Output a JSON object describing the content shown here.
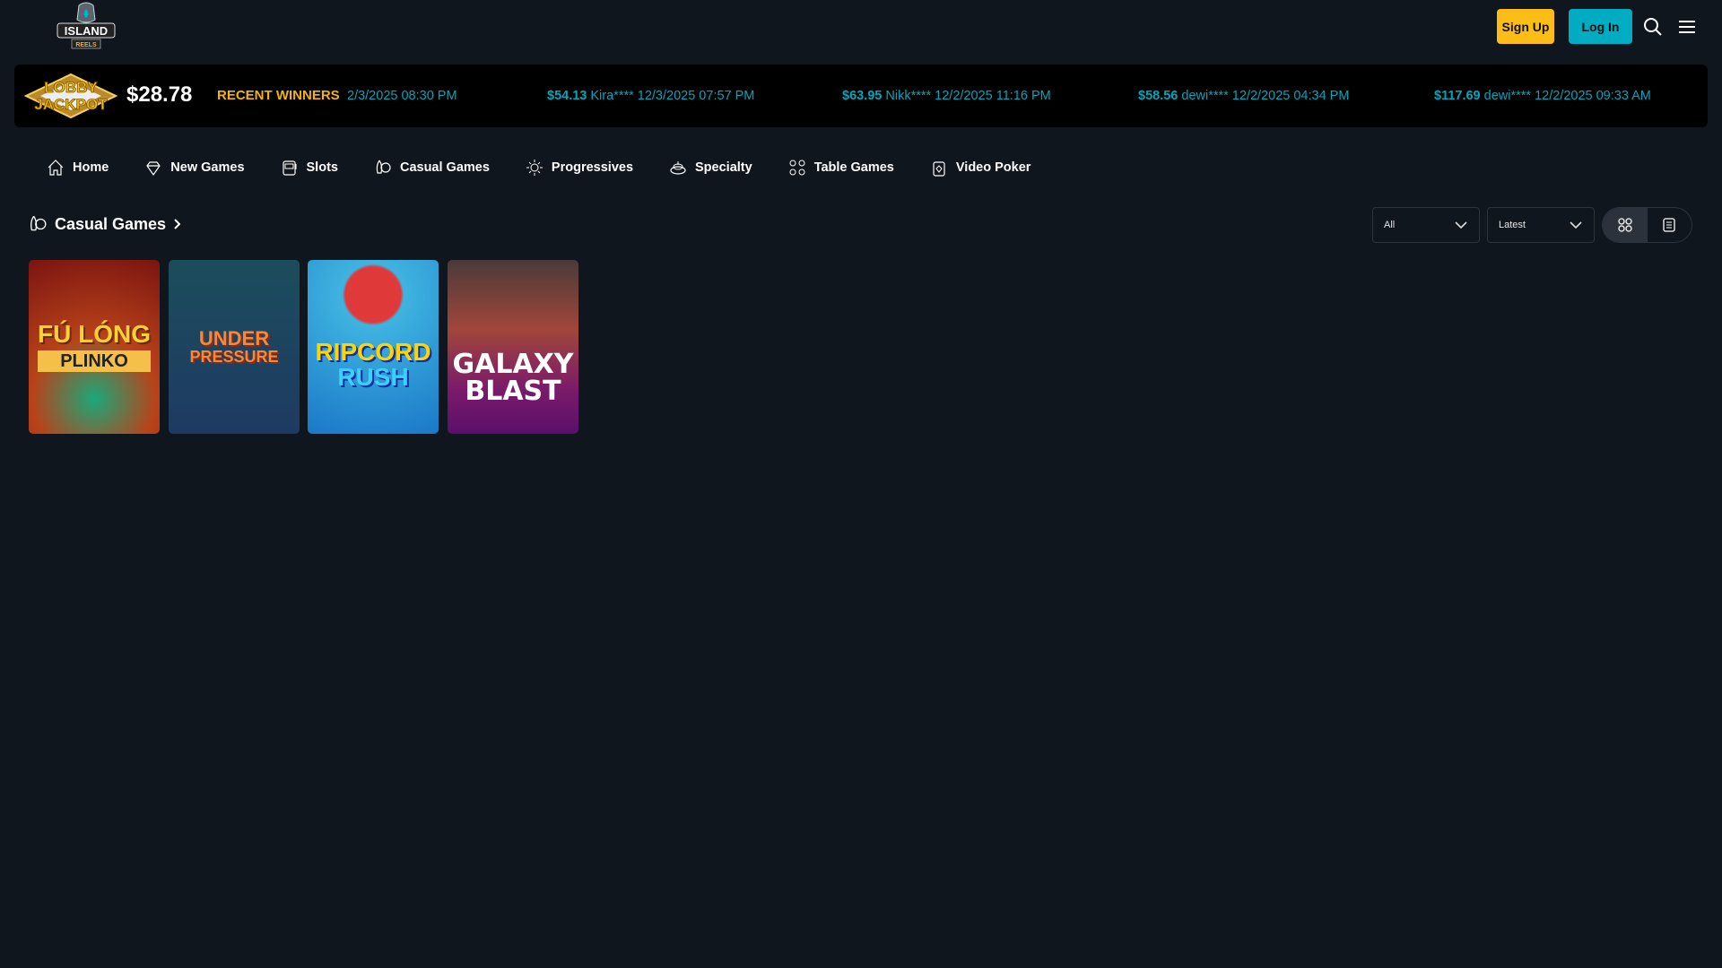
{
  "header": {
    "logo_text": "ISLAND REELS",
    "signup_label": "Sign Up",
    "login_label": "Log In",
    "accent_yellow": "#fdbd17",
    "accent_teal": "#00acc1"
  },
  "ticker": {
    "jackpot_logo_text": "LOBBY JACKPOT",
    "jackpot_amount": "$28.78",
    "recent_label": "RECENT WINNERS",
    "first_partial": "2/3/2025 08:30 PM",
    "winners": [
      {
        "amount": "$54.13",
        "rest": "Kira**** 12/3/2025 07:57 PM"
      },
      {
        "amount": "$63.95",
        "rest": "Nikk**** 12/2/2025 11:16 PM"
      },
      {
        "amount": "$58.56",
        "rest": "dewi**** 12/2/2025 04:34 PM"
      },
      {
        "amount": "$117.69",
        "rest": "dewi**** 12/2/2025 09:33 AM"
      }
    ]
  },
  "nav": [
    {
      "label": "Home",
      "icon": "home-icon"
    },
    {
      "label": "New Games",
      "icon": "diamond-icon"
    },
    {
      "label": "Slots",
      "icon": "slot-machine-icon"
    },
    {
      "label": "Casual Games",
      "icon": "rocket-coin-icon"
    },
    {
      "label": "Progressives",
      "icon": "dollar-burst-icon"
    },
    {
      "label": "Specialty",
      "icon": "specialty-icon"
    },
    {
      "label": "Table Games",
      "icon": "card-suits-icon"
    },
    {
      "label": "Video Poker",
      "icon": "poker-card-icon"
    }
  ],
  "section": {
    "title": "Casual Games",
    "filter_value": "All",
    "sort_value": "Latest",
    "view_mode": "grid"
  },
  "games": [
    {
      "title": "FU LONG PLINKO",
      "line1": "FÚ LÓNG",
      "line2": "PLINKO"
    },
    {
      "title": "UNDER PRESSURE",
      "line1": "UNDER",
      "line2": "PRESSURE"
    },
    {
      "title": "RIPCORD RUSH",
      "line1": "RIPCORD",
      "line2": "RUSH"
    },
    {
      "title": "GALAXY BLAST",
      "line1": "GALAXY",
      "line2": "BLAST"
    }
  ]
}
